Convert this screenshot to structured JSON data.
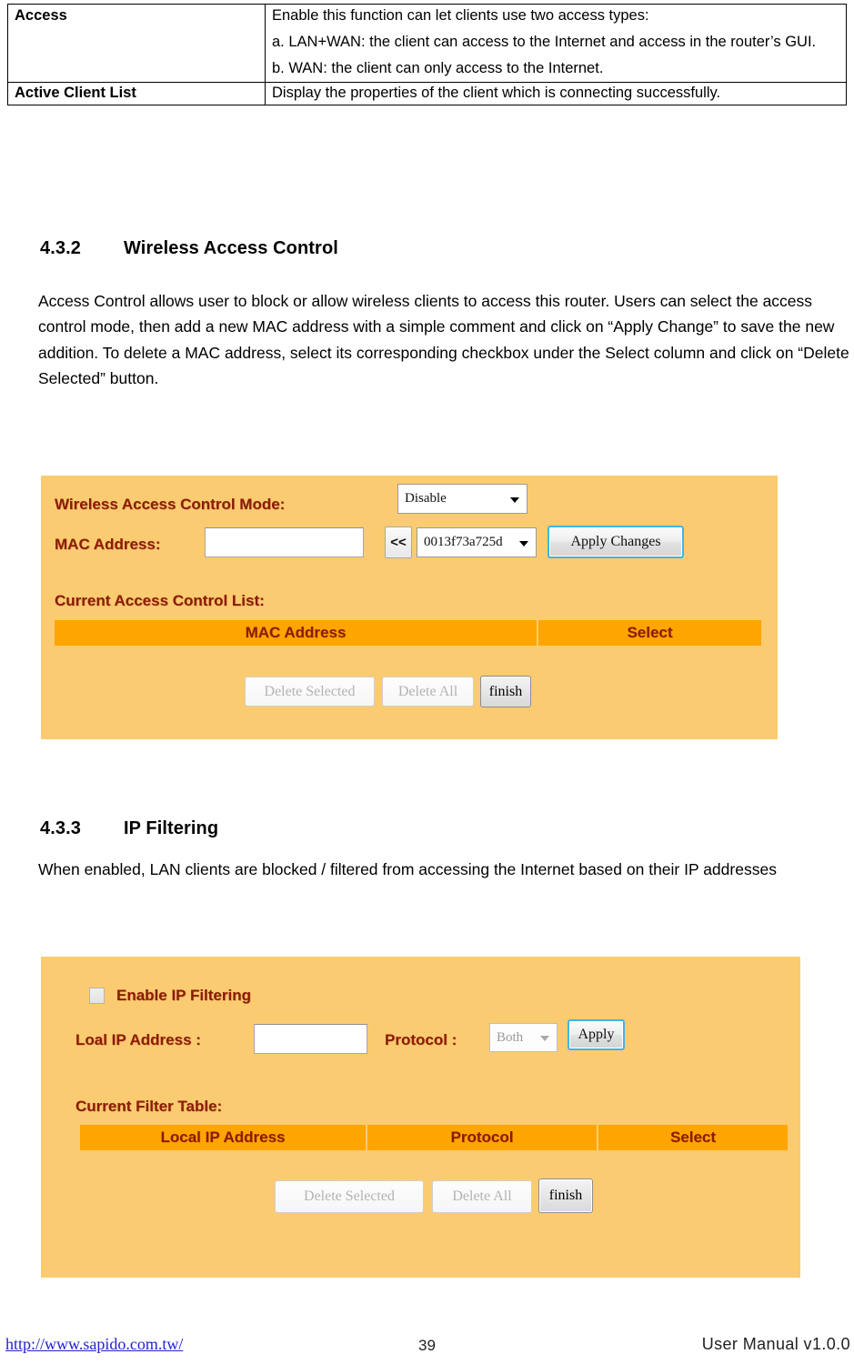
{
  "definition_table": {
    "rows": [
      {
        "term": "Access",
        "lines": [
          "Enable this function can let clients use two access types:",
          "a. LAN+WAN: the client can access to the Internet and access in the router’s GUI.",
          "b. WAN: the client can only access to the Internet."
        ]
      },
      {
        "term": "Active Client List",
        "lines": [
          "Display the properties of the client which is connecting successfully."
        ]
      }
    ]
  },
  "sections": [
    {
      "number": "4.3.2",
      "title": "Wireless Access Control",
      "body": "Access Control allows user to block or allow wireless clients to access this router. Users can select the access control mode, then add a new MAC address with a simple comment and click on “Apply Change” to save the new addition. To delete a MAC address, select its corresponding checkbox under the Select column and click on “Delete Selected” button."
    },
    {
      "number": "4.3.3",
      "title": "IP Filtering",
      "body": "When enabled, LAN clients are blocked / filtered from accessing the Internet based on their IP addresses"
    }
  ],
  "wireless_access_control_panel": {
    "mode_label": "Wireless Access Control Mode:",
    "mode_value": "Disable",
    "mac_label": "MAC Address:",
    "mac_value": "",
    "mac_placeholder": "",
    "insert_button_label": "<<",
    "mac_list_value": "0013f73a725d",
    "apply_button_label": "Apply Changes",
    "list_heading": "Current Access Control List:",
    "table_headers": [
      "MAC Address",
      "Select"
    ],
    "delete_selected_label": "Delete Selected",
    "delete_all_label": "Delete All",
    "finish_label": "finish"
  },
  "ip_filtering_panel": {
    "enable_label": "Enable IP Filtering",
    "enable_checked": false,
    "local_ip_label": "Loal IP Address :",
    "local_ip_value": "",
    "protocol_label": "Protocol :",
    "protocol_value": "Both",
    "apply_button_label": "Apply",
    "list_heading": "Current Filter Table:",
    "table_headers": [
      "Local IP Address",
      "Protocol",
      "Select"
    ],
    "delete_selected_label": "Delete Selected",
    "delete_all_label": "Delete All",
    "finish_label": "finish"
  },
  "footer": {
    "url": "http://www.sapido.com.tw/",
    "page_number": "39",
    "manual_version": "User  Manual  v1.0.0"
  },
  "colors": {
    "panel_background": "#FBCB72",
    "table_header_background": "#FFA500",
    "label_text": "#8C1C04",
    "link": "#2222CC",
    "focus_ring": "#3FB4E8"
  }
}
